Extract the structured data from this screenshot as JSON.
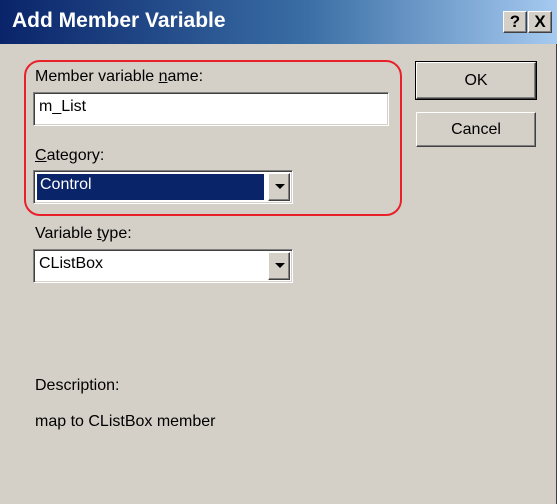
{
  "window": {
    "title": "Add Member Variable"
  },
  "title_buttons": {
    "help": "?",
    "close": "X"
  },
  "form": {
    "name_label": {
      "before": "Member variable ",
      "accel": "n",
      "after": "ame:"
    },
    "name_value": "m_List",
    "category_label": {
      "accel": "C",
      "after": "ategory:"
    },
    "category_value": "Control",
    "type_label": {
      "before": "Variable ",
      "accel": "t",
      "after": "ype:"
    },
    "type_value": "CListBox",
    "description_label": "Description:",
    "description_text": "map to CListBox member"
  },
  "buttons": {
    "ok": "OK",
    "cancel": "Cancel"
  },
  "annotation": {
    "highlight_color": "#e8202a"
  },
  "colors": {
    "titlebar": "#0a246a",
    "selection": "#0a246a",
    "face": "#d4d0c8"
  },
  "icons": {
    "dropdown": "chevron-down-icon"
  }
}
